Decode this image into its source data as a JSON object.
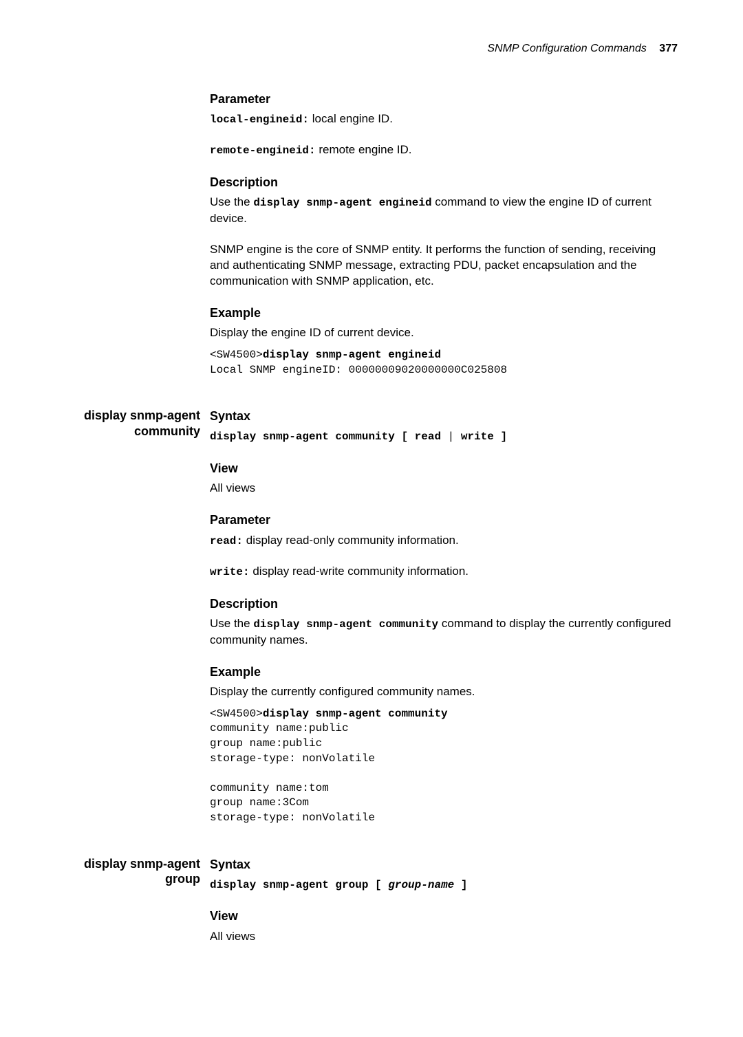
{
  "header": {
    "section_title": "SNMP Configuration Commands",
    "page_number": "377"
  },
  "sections": [
    {
      "side_label": "",
      "blocks": [
        {
          "heading": "Parameter",
          "paras": [
            {
              "parts": [
                {
                  "t": "code-bold",
                  "v": "local-engineid:"
                },
                {
                  "t": "text",
                  "v": " local engine ID."
                }
              ]
            },
            {
              "gap": "s"
            },
            {
              "parts": [
                {
                  "t": "code-bold",
                  "v": "remote-engineid:"
                },
                {
                  "t": "text",
                  "v": " remote engine ID."
                }
              ]
            }
          ]
        },
        {
          "heading": "Description",
          "paras": [
            {
              "parts": [
                {
                  "t": "text",
                  "v": "Use the "
                },
                {
                  "t": "code-bold",
                  "v": "display snmp-agent engineid"
                },
                {
                  "t": "text",
                  "v": " command to view the engine ID of current device."
                }
              ]
            },
            {
              "gap": "s"
            },
            {
              "parts": [
                {
                  "t": "text",
                  "v": "SNMP engine is the core of SNMP entity. It performs the function of sending, receiving and authenticating SNMP message, extracting PDU, packet encapsulation and the communication with SNMP application, etc."
                }
              ]
            }
          ]
        },
        {
          "heading": "Example",
          "paras": [
            {
              "parts": [
                {
                  "t": "text",
                  "v": "Display the engine ID of current device."
                }
              ]
            }
          ],
          "pre_lines": [
            [
              {
                "t": "mono",
                "v": "<SW4500>"
              },
              {
                "t": "mono-bold",
                "v": "display snmp-agent engineid"
              }
            ],
            [
              {
                "t": "mono",
                "v": "Local SNMP engineID: 00000009020000000C025808"
              }
            ]
          ]
        }
      ]
    },
    {
      "side_label": "display snmp-agent community",
      "blocks": [
        {
          "heading": "Syntax",
          "paras": [
            {
              "parts": [
                {
                  "t": "code-bold",
                  "v": "display snmp-agent community [ read "
                },
                {
                  "t": "code",
                  "v": "|"
                },
                {
                  "t": "code-bold",
                  "v": " write ]"
                }
              ]
            }
          ]
        },
        {
          "heading": "View",
          "paras": [
            {
              "parts": [
                {
                  "t": "text",
                  "v": "All views"
                }
              ]
            }
          ]
        },
        {
          "heading": "Parameter",
          "paras": [
            {
              "parts": [
                {
                  "t": "code-bold",
                  "v": "read:"
                },
                {
                  "t": "text",
                  "v": " display read-only community information."
                }
              ]
            },
            {
              "gap": "s"
            },
            {
              "parts": [
                {
                  "t": "code-bold",
                  "v": "write:"
                },
                {
                  "t": "text",
                  "v": " display read-write community information."
                }
              ]
            }
          ]
        },
        {
          "heading": "Description",
          "paras": [
            {
              "parts": [
                {
                  "t": "text",
                  "v": "Use the "
                },
                {
                  "t": "code-bold",
                  "v": "display snmp-agent community"
                },
                {
                  "t": "text",
                  "v": " command to display the currently configured community names."
                }
              ]
            }
          ]
        },
        {
          "heading": "Example",
          "paras": [
            {
              "parts": [
                {
                  "t": "text",
                  "v": "Display the currently configured community names."
                }
              ]
            }
          ],
          "pre_lines": [
            [
              {
                "t": "mono",
                "v": "<SW4500>"
              },
              {
                "t": "mono-bold",
                "v": "display snmp-agent community"
              }
            ],
            [
              {
                "t": "mono",
                "v": "community name:public"
              }
            ],
            [
              {
                "t": "mono",
                "v": "group name:public"
              }
            ],
            [
              {
                "t": "mono",
                "v": "storage-type: nonVolatile"
              }
            ],
            [
              {
                "t": "mono",
                "v": ""
              }
            ],
            [
              {
                "t": "mono",
                "v": "community name:tom"
              }
            ],
            [
              {
                "t": "mono",
                "v": "group name:3Com"
              }
            ],
            [
              {
                "t": "mono",
                "v": "storage-type: nonVolatile"
              }
            ]
          ]
        }
      ]
    },
    {
      "side_label": "display snmp-agent group",
      "blocks": [
        {
          "heading": "Syntax",
          "paras": [
            {
              "parts": [
                {
                  "t": "code-bold",
                  "v": "display snmp-agent group [ "
                },
                {
                  "t": "code-italic-bold",
                  "v": "group-name"
                },
                {
                  "t": "code-bold",
                  "v": " ]"
                }
              ]
            }
          ]
        },
        {
          "heading": "View",
          "paras": [
            {
              "parts": [
                {
                  "t": "text",
                  "v": "All views"
                }
              ]
            }
          ]
        }
      ]
    }
  ]
}
